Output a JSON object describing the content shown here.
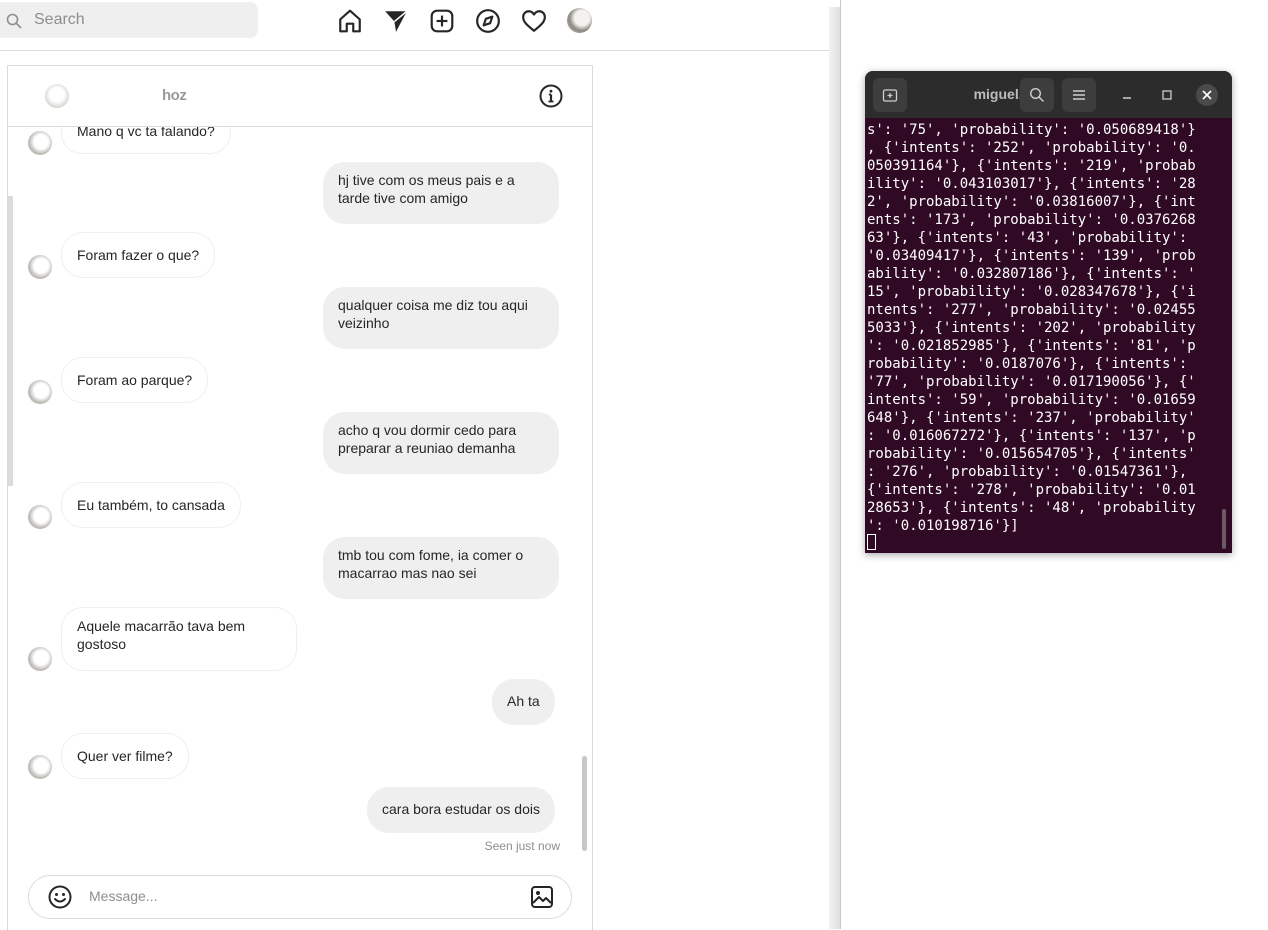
{
  "search": {
    "placeholder": "Search"
  },
  "nav": {
    "icons": [
      "home-icon",
      "direct-icon",
      "new-post-icon",
      "explore-icon",
      "activity-icon",
      "profile-avatar"
    ]
  },
  "chat": {
    "header_name": "hoz",
    "messages": [
      {
        "dir": "in",
        "text": "Mano q vc ta falando?"
      },
      {
        "dir": "out",
        "text": "hj tive com os meus pais e a tarde tive com amigo"
      },
      {
        "dir": "in",
        "text": "Foram fazer o que?"
      },
      {
        "dir": "out",
        "text": "qualquer coisa me diz tou aqui veizinho"
      },
      {
        "dir": "in",
        "text": "Foram ao parque?"
      },
      {
        "dir": "out",
        "text": "acho q vou dormir cedo para preparar a reuniao demanha"
      },
      {
        "dir": "in",
        "text": "Eu também, to cansada"
      },
      {
        "dir": "out",
        "text": "tmb tou com fome, ia comer o macarrao mas nao sei"
      },
      {
        "dir": "in",
        "text": "Aquele macarrão tava bem gostoso"
      },
      {
        "dir": "out",
        "text": "Ah ta"
      },
      {
        "dir": "in",
        "text": "Quer ver filme?"
      },
      {
        "dir": "out",
        "text": "cara bora estudar os dois"
      }
    ],
    "seen": "Seen just now",
    "composer_placeholder": "Message..."
  },
  "terminal": {
    "title": "miguel...",
    "lines": [
      "s': '75', 'probability': '0.050689418'}",
      ", {'intents': '252', 'probability': '0.",
      "050391164'}, {'intents': '219', 'probab",
      "ility': '0.043103017'}, {'intents': '28",
      "2', 'probability': '0.03816007'}, {'int",
      "ents': '173', 'probability': '0.0376268",
      "63'}, {'intents': '43', 'probability':",
      "'0.03409417'}, {'intents': '139', 'prob",
      "ability': '0.032807186'}, {'intents': '",
      "15', 'probability': '0.028347678'}, {'i",
      "ntents': '277', 'probability': '0.02455",
      "5033'}, {'intents': '202', 'probability",
      "': '0.021852985'}, {'intents': '81', 'p",
      "robability': '0.0187076'}, {'intents':",
      "'77', 'probability': '0.017190056'}, {'",
      "intents': '59', 'probability': '0.01659",
      "648'}, {'intents': '237', 'probability'",
      ": '0.016067272'}, {'intents': '137', 'p",
      "robability': '0.015654705'}, {'intents'",
      ": '276', 'probability': '0.01547361'},",
      "{'intents': '278', 'probability': '0.01",
      "28653'}, {'intents': '48', 'probability",
      "': '0.010198716'}]"
    ]
  }
}
